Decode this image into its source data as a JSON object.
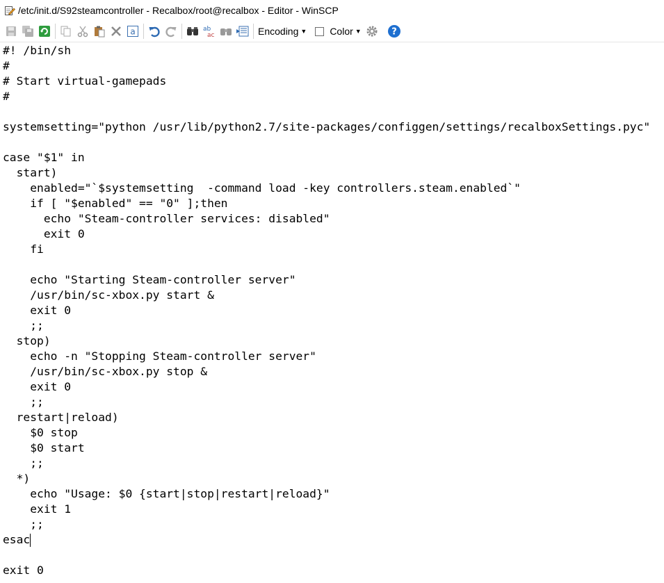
{
  "window": {
    "title": "/etc/init.d/S92steamcontroller - Recalbox/root@recalbox - Editor - WinSCP"
  },
  "toolbar": {
    "encoding_label": "Encoding",
    "color_label": "Color"
  },
  "editor": {
    "lines": [
      "#! /bin/sh",
      "#",
      "# Start virtual-gamepads",
      "#",
      "",
      "systemsetting=\"python /usr/lib/python2.7/site-packages/configgen/settings/recalboxSettings.pyc\"",
      "",
      "case \"$1\" in",
      "  start)",
      "    enabled=\"`$systemsetting  -command load -key controllers.steam.enabled`\"",
      "    if [ \"$enabled\" == \"0\" ];then",
      "      echo \"Steam-controller services: disabled\"",
      "      exit 0",
      "    fi",
      "",
      "    echo \"Starting Steam-controller server\"",
      "    /usr/bin/sc-xbox.py start &",
      "    exit 0",
      "    ;;",
      "  stop)",
      "    echo -n \"Stopping Steam-controller server\"",
      "    /usr/bin/sc-xbox.py stop &",
      "    exit 0",
      "    ;;",
      "  restart|reload)",
      "    $0 stop",
      "    $0 start",
      "    ;;",
      "  *)",
      "    echo \"Usage: $0 {start|stop|restart|reload}\"",
      "    exit 1",
      "    ;;",
      "esac",
      "",
      "exit 0"
    ]
  }
}
